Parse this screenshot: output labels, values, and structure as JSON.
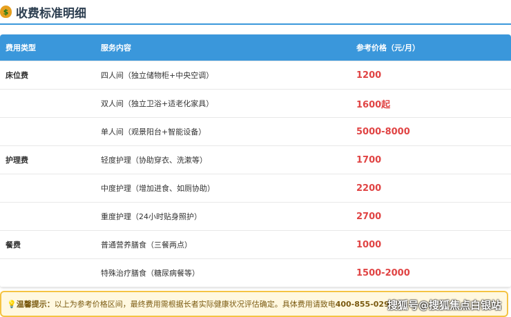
{
  "title": "收费标准明细",
  "header": [
    "费用类型",
    "服务内容",
    "参考价格（元/月）"
  ],
  "rows": [
    {
      "type": "床位费",
      "service": "四人间（独立储物柜+中央空调）",
      "price": "1200"
    },
    {
      "type": "",
      "service": "双人间（独立卫浴+适老化家具）",
      "price": "1600起"
    },
    {
      "type": "",
      "service": "单人间（观景阳台+智能设备）",
      "price": "5000-8000"
    },
    {
      "type": "护理费",
      "service": "轻度护理（协助穿衣、洗漱等）",
      "price": "1700"
    },
    {
      "type": "",
      "service": "中度护理（增加进食、如厕协助）",
      "price": "2200"
    },
    {
      "type": "",
      "service": "重度护理（24小时贴身照护）",
      "price": "2700"
    },
    {
      "type": "餐费",
      "service": "普通营养膳食（三餐两点）",
      "price": "1000"
    },
    {
      "type": "",
      "service": "特殊治疗膳食（糖尿病餐等）",
      "price": "1500-2000"
    }
  ],
  "tip": {
    "label": "温馨提示：",
    "text": "以上为参考价格区间，最终费用需根据长者实际健康状况评估确定。具体费用请致电 ",
    "phone": "400-855-0290"
  },
  "watermark": "搜狐号@搜狐焦点白银站"
}
